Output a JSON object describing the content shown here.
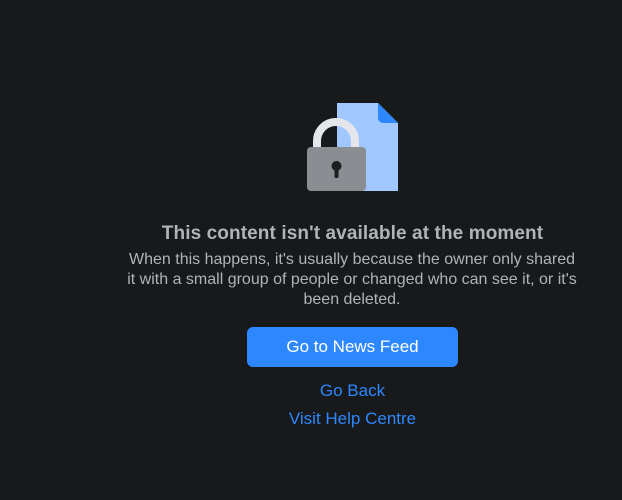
{
  "message": {
    "title": "This content isn't available at the moment",
    "description": "When this happens, it's usually because the owner only shared it with a small group of people or changed who can see it, or it's been deleted."
  },
  "actions": {
    "news_feed_label": "Go to News Feed",
    "go_back_label": "Go Back",
    "help_centre_label": "Visit Help Centre"
  },
  "icons": {
    "illustration": "locked-document-icon"
  },
  "colors": {
    "background": "#18191a",
    "text_secondary": "#b0b3b8",
    "accent": "#2d88ff",
    "document": "#a0c8ff",
    "document_fold": "#2d88ff",
    "lock_body": "#8a8d91",
    "lock_shackle": "#e4e6eb"
  }
}
